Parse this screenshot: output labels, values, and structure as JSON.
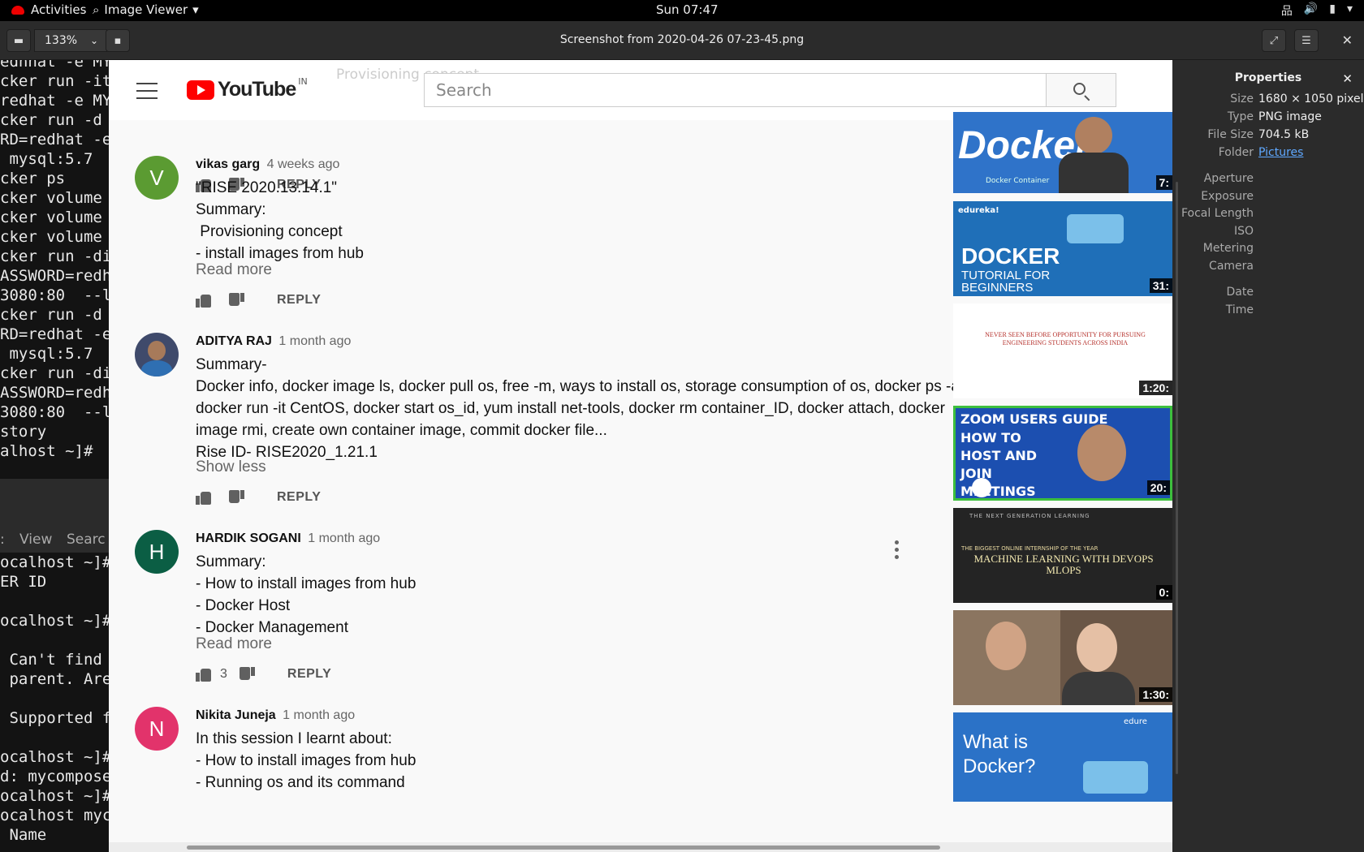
{
  "topbar": {
    "activities": "Activities",
    "app_name": "Image Viewer",
    "clock": "Sun 07:47"
  },
  "headerbar": {
    "zoom_level": "133%",
    "window_title": "Screenshot from 2020-04-26 07-23-45.png"
  },
  "terminal": {
    "lines_top": [
      "ednhat -e MY",
      "cker run -it",
      "redhat -e MY",
      "cker run -d ",
      "RD=redhat -e",
      " mysql:5.7",
      "cker ps",
      "cker volume ",
      "cker volume ",
      "cker volume ",
      "cker run -di",
      "ASSWORD=redh",
      "3080:80  --l",
      "cker run -d ",
      "RD=redhat -e",
      " mysql:5.7",
      "cker run -di",
      "ASSWORD=redh",
      "3080:80  --l",
      "story",
      "alhost ~]# "
    ],
    "menu": [
      "View",
      "Searc"
    ],
    "lines_bottom": [
      "ocalhost ~]#",
      "ER ID",
      "",
      "ocalhost ~]#",
      "",
      " Can't find ",
      " parent. Are",
      "",
      " Supported f",
      "",
      "ocalhost ~]#",
      "d: mycompose",
      "ocalhost ~]#",
      "ocalhost myc",
      " Name"
    ]
  },
  "youtube": {
    "logo_text": "YouTube",
    "country": "IN",
    "search_placeholder": "Search",
    "ghost_text": "Provisioning concept",
    "reply_label": "REPLY",
    "comments": [
      {
        "author": "vikas garg",
        "age": "4 weeks ago",
        "avatar_letter": "V",
        "avatar_color": "#5b9b32",
        "text": "\"RISE 2020.13.14.1\"\nSummary:\n Provisioning concept\n- install images from hub",
        "toggle": "Read more"
      },
      {
        "author": "ADITYA RAJ",
        "age": "1 month ago",
        "avatar_letter": "",
        "avatar_color": "#3f4a6b",
        "text": "Summary-\nDocker info, docker image ls, docker pull os, free -m, ways to install os, storage consumption of os, docker ps -a, docker run -it CentOS, docker start os_id, yum install net-tools, docker rm container_ID, docker attach, docker image rmi, create own container image, commit docker file...\nRise ID- RISE2020_1.21.1",
        "toggle": "Show less"
      },
      {
        "author": "HARDIK SOGANI",
        "age": "1 month ago",
        "avatar_letter": "H",
        "avatar_color": "#0b5e44",
        "text": "Summary:\n- How to install images from hub\n- Docker Host\n- Docker Management",
        "toggle": "Read more",
        "likes": "3"
      },
      {
        "author": "Nikita Juneja",
        "age": "1 month ago",
        "avatar_letter": "N",
        "avatar_color": "#e2336b",
        "text": "In this session I learnt about:\n- How to install images from hub\n- Running os and its command",
        "toggle": ""
      }
    ],
    "videos": [
      {
        "title": "Docker",
        "sub": "Docker Container",
        "duration": "7:",
        "bg": "#2f73c9"
      },
      {
        "title": "DOCKER",
        "sub": "TUTORIAL FOR BEGINNERS",
        "brand": "edureka!",
        "duration": "31:",
        "bg": "#1f6fb8"
      },
      {
        "title": "NEVER SEEN BEFORE OPPORTUNITY FOR PURSUING ENGINEERING STUDENTS ACROSS INDIA",
        "duration": "1:20:",
        "bg": "#ffffff"
      },
      {
        "title": "ZOOM USERS GUIDE",
        "sub": "HOW TO HOST AND JOIN MEETINGS",
        "duration": "20:",
        "bg": "#1c4fb0"
      },
      {
        "title": "MACHINE LEARNING WITH DEVOPS MLOPS",
        "sub": "THE BIGGEST ONLINE INTERNSHIP OF THE YEAR",
        "header": "THE NEXT GENERATION LEARNING",
        "duration": "0:",
        "bg": "#242424"
      },
      {
        "title": "",
        "duration": "1:30:",
        "bg": "#6a5646"
      },
      {
        "title": "What is Docker?",
        "brand": "edure",
        "duration": "",
        "bg": "#2b72c7"
      }
    ]
  },
  "properties": {
    "title": "Properties",
    "rows": [
      {
        "key": "Size",
        "value": "1680 × 1050 pixels"
      },
      {
        "key": "Type",
        "value": "PNG image"
      },
      {
        "key": "File Size",
        "value": "704.5 kB"
      },
      {
        "key": "Folder",
        "value": "Pictures"
      },
      {
        "key": "Aperture",
        "value": ""
      },
      {
        "key": "Exposure",
        "value": ""
      },
      {
        "key": "Focal Length",
        "value": ""
      },
      {
        "key": "ISO",
        "value": ""
      },
      {
        "key": "Metering",
        "value": ""
      },
      {
        "key": "Camera",
        "value": ""
      },
      {
        "key": "Date",
        "value": ""
      },
      {
        "key": "Time",
        "value": ""
      }
    ]
  }
}
